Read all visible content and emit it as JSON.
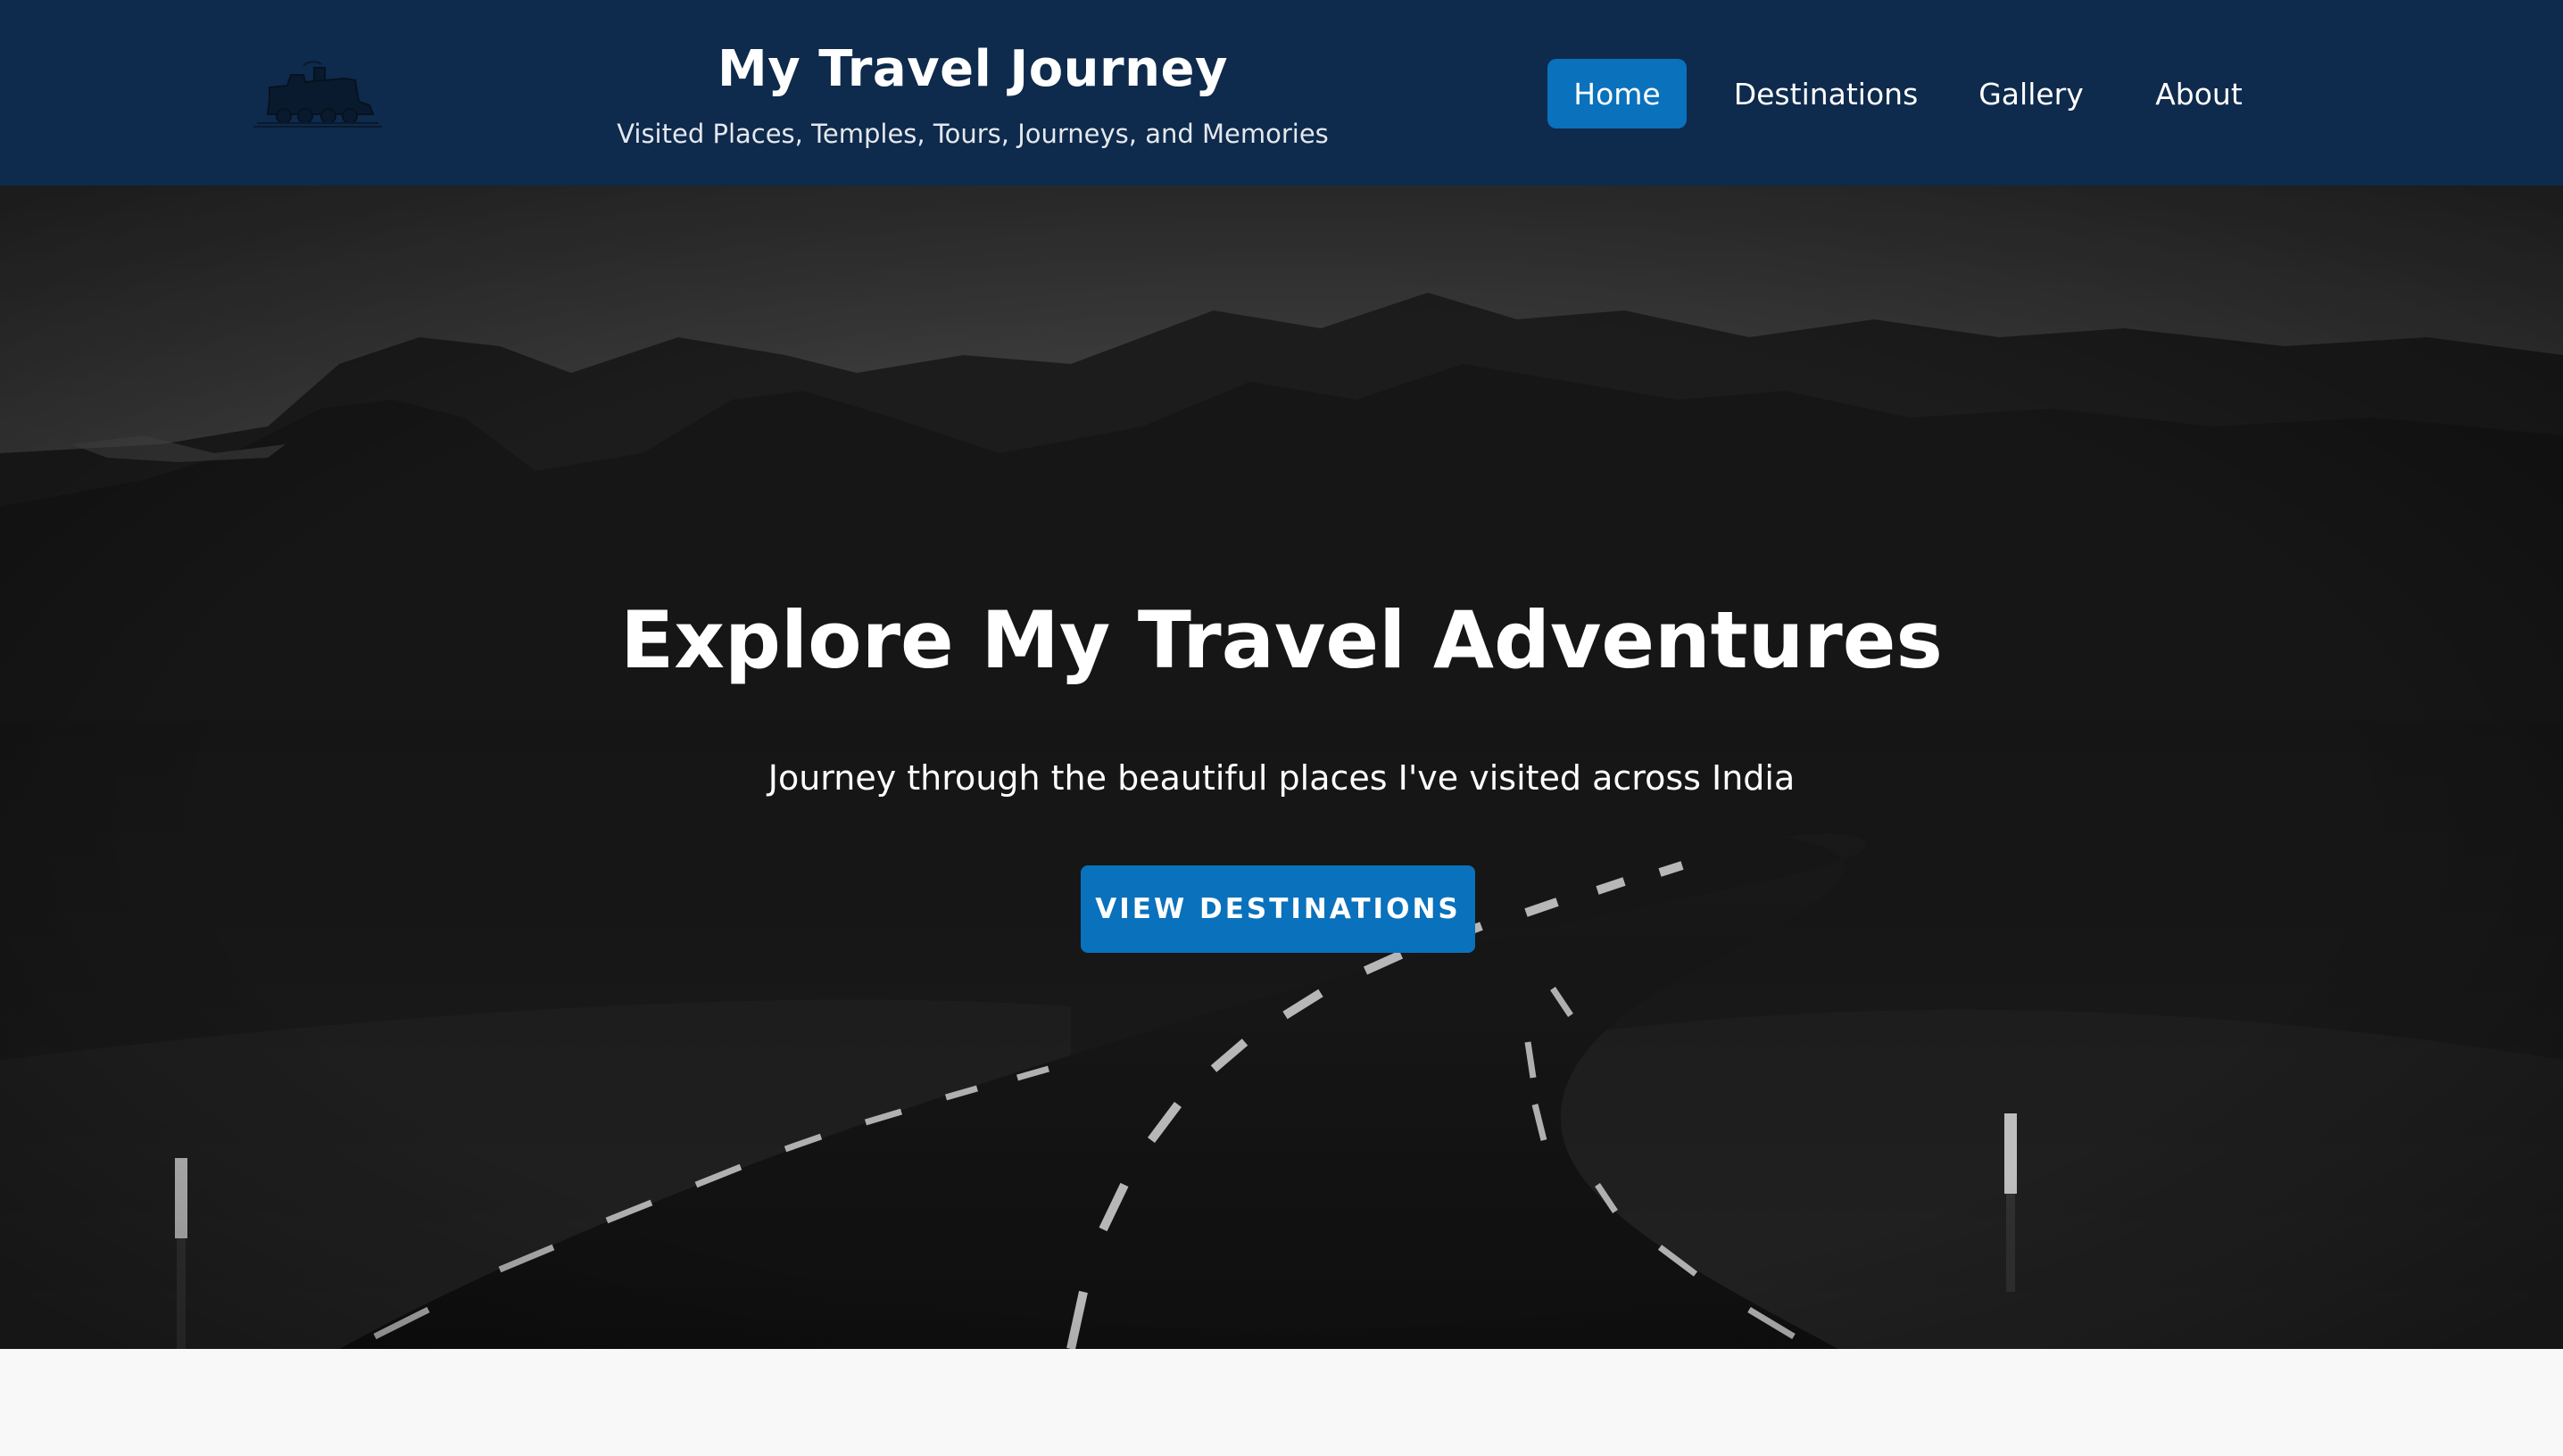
{
  "header": {
    "logo_icon": "train-icon",
    "title": "My Travel Journey",
    "tagline": "Visited Places, Temples, Tours, Journeys, and Memories"
  },
  "nav": {
    "items": [
      {
        "label": "Home",
        "active": true
      },
      {
        "label": "Destinations",
        "active": false
      },
      {
        "label": "Gallery",
        "active": false
      },
      {
        "label": "About",
        "active": false
      }
    ]
  },
  "hero": {
    "title": "Explore My Travel Adventures",
    "subtitle": "Journey through the beautiful places I've visited across India",
    "button_label": "VIEW DESTINATIONS",
    "background": "winding-road-mountains-photo"
  },
  "colors": {
    "header_bg": "#0e2a4c",
    "accent": "#0a71bd",
    "page_bg": "#f8f8f8"
  }
}
